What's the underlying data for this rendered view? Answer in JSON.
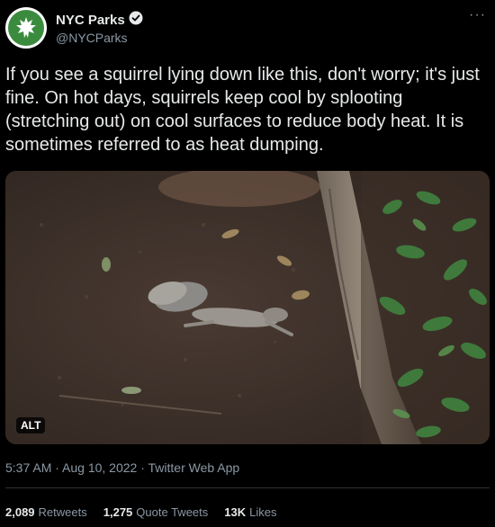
{
  "author": {
    "display_name": "NYC Parks",
    "handle": "@NYCParks",
    "verified": true,
    "avatar_icon": "leaf-logo-icon",
    "avatar_color": "#3b8b3f"
  },
  "tweet": {
    "text": "If you see a squirrel lying down like this, don't worry; it's just fine. On hot days, squirrels keep cool by splooting (stretching out) on cool surfaces to reduce body heat. It is sometimes referred to as heat dumping.",
    "media_alt_badge": "ALT",
    "media_icon": "photo-squirrel-splooting",
    "timestamp": "5:37 AM · Aug 10, 2022 · Twitter Web App"
  },
  "stats": {
    "retweets_count": "2,089",
    "retweets_label": "Retweets",
    "quotes_count": "1,275",
    "quotes_label": "Quote Tweets",
    "likes_count": "13K",
    "likes_label": "Likes"
  },
  "menu": {
    "more_label": "···"
  }
}
